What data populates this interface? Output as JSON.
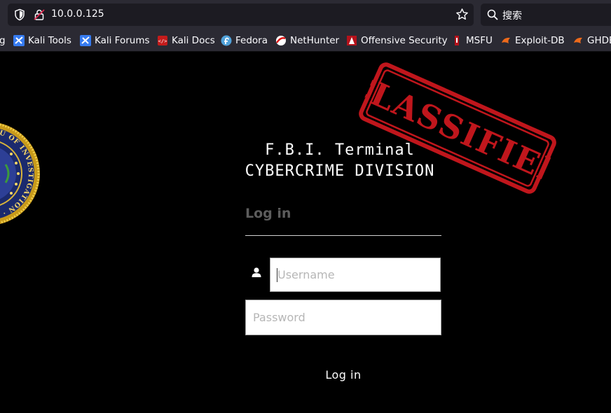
{
  "browser": {
    "url": "10.0.0.125",
    "search_placeholder": "搜索",
    "bookmarks": [
      {
        "label": "g",
        "icon": "bookmark-partial-icon"
      },
      {
        "label": "Kali Tools",
        "icon": "kali-icon"
      },
      {
        "label": "Kali Forums",
        "icon": "kali-icon"
      },
      {
        "label": "Kali Docs",
        "icon": "kali-docs-icon"
      },
      {
        "label": "Fedora",
        "icon": "fedora-icon"
      },
      {
        "label": "NetHunter",
        "icon": "nethunter-icon"
      },
      {
        "label": "Offensive Security",
        "icon": "offsec-icon"
      },
      {
        "label": "MSFU",
        "icon": "msfu-icon"
      },
      {
        "label": "Exploit-DB",
        "icon": "exploit-db-icon"
      },
      {
        "label": "GHDB",
        "icon": "ghdb-icon"
      }
    ]
  },
  "page": {
    "seal_text": "FEDERAL BUREAU OF INVESTIGATION · DEPARTMENT OF JUSTICE",
    "stamp_text": "CLASSIFIED",
    "title_line1": "F.B.I. Terminal",
    "title_line2": "CYBERCRIME DIVISION",
    "login_heading": "Log in",
    "username_placeholder": "Username",
    "password_placeholder": "Password",
    "login_button": "Log in"
  },
  "colors": {
    "chrome_bg": "#2b2a33",
    "field_bg": "#1c1b22",
    "page_bg": "#000000",
    "stamp_red": "#c0161c",
    "heading_gray": "#5d5d5d"
  }
}
